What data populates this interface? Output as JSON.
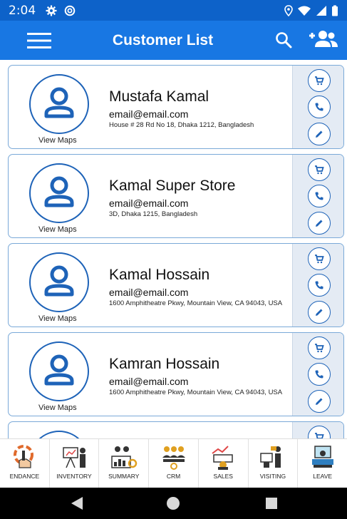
{
  "status_bar": {
    "time": "2:04"
  },
  "app_bar": {
    "title": "Customer List"
  },
  "customers": [
    {
      "name": "Mustafa Kamal",
      "email": "email@email.com",
      "address": "House # 28 Rd No 18, Dhaka 1212, Bangladesh",
      "map_link": "View Maps"
    },
    {
      "name": "Kamal Super Store",
      "email": "email@email.com",
      "address": "3D, Dhaka 1215, Bangladesh",
      "map_link": "View Maps"
    },
    {
      "name": "Kamal Hossain",
      "email": "email@email.com",
      "address": "1600 Amphitheatre Pkwy, Mountain View, CA 94043, USA",
      "map_link": "View Maps"
    },
    {
      "name": "Kamran Hossain",
      "email": "email@email.com",
      "address": "1600 Amphitheatre Pkwy, Mountain View, CA 94043, USA",
      "map_link": "View Maps"
    }
  ],
  "card_actions": [
    "cart-icon",
    "phone-icon",
    "edit-icon"
  ],
  "bottom_nav": [
    {
      "label": "ENDANCE",
      "icon": "attendance-icon"
    },
    {
      "label": "INVENTORY",
      "icon": "inventory-icon"
    },
    {
      "label": "SUMMARY",
      "icon": "summary-icon"
    },
    {
      "label": "CRM",
      "icon": "crm-icon"
    },
    {
      "label": "SALES",
      "icon": "sales-icon"
    },
    {
      "label": "VISITING",
      "icon": "visiting-icon"
    },
    {
      "label": "LEAVE",
      "icon": "leave-icon"
    }
  ],
  "colors": {
    "status_bar": "#0d62c9",
    "app_bar": "#1877e3",
    "accent": "#1e63b8",
    "card_border": "#7aa9d8",
    "action_panel": "#e4ebf4"
  }
}
